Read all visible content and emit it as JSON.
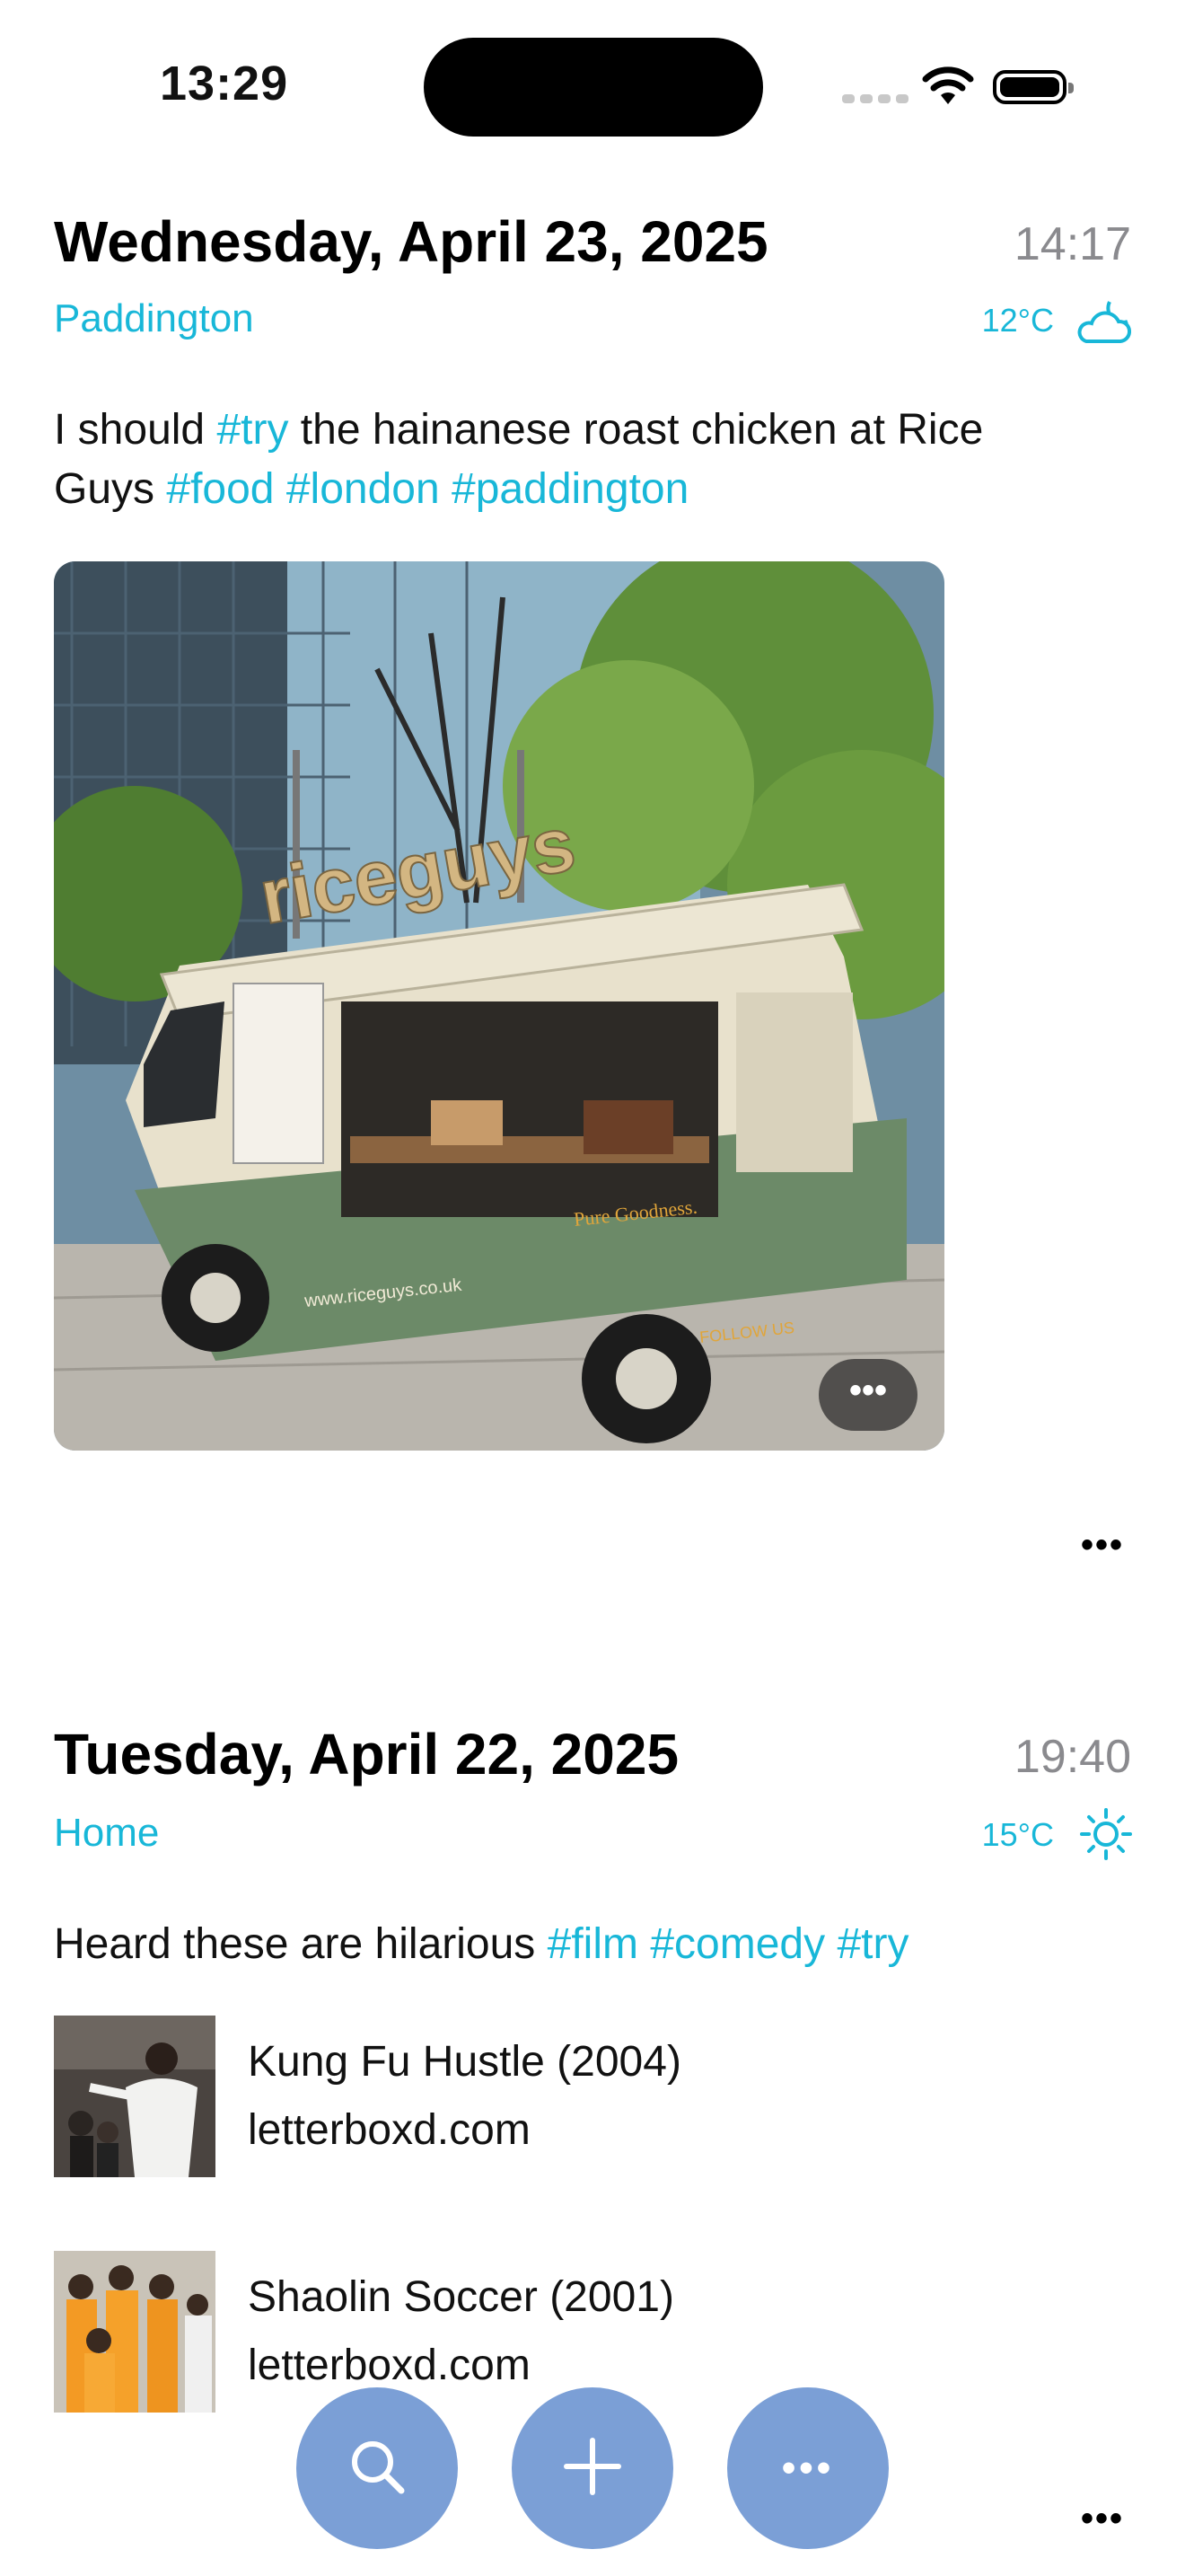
{
  "status_bar": {
    "time": "13:29"
  },
  "entries": [
    {
      "date": "Wednesday, April 23, 2025",
      "time": "14:17",
      "location": "Paddington",
      "temperature": "12°C",
      "weather_icon": "partly-cloudy-night-icon",
      "text_plain_1": "I should ",
      "tag_1": "#try",
      "text_plain_2": " the hainanese roast chicken at Rice Guys ",
      "tag_2": "#food",
      "tag_3": "#london",
      "tag_4": "#paddington",
      "photo": {
        "sign": "riceguys",
        "website": "www.riceguys.co.uk",
        "slogan": "Pure Goodness.",
        "follow": "FOLLOW US"
      },
      "photo_more_label": "•••",
      "more_label": "•••"
    },
    {
      "date": "Tuesday, April 22, 2025",
      "time": "19:40",
      "location": "Home",
      "temperature": "15°C",
      "weather_icon": "sun-icon",
      "text_plain_1": "Heard these are hilarious ",
      "tag_1": "#film",
      "tag_2": "#comedy",
      "tag_3": "#try",
      "links": [
        {
          "title": "Kung Fu Hustle (2004)",
          "domain": "letterboxd.com"
        },
        {
          "title": "Shaolin Soccer (2001)",
          "domain": "letterboxd.com"
        }
      ],
      "more_label": "•••"
    }
  ],
  "toolbar": {
    "search_icon": "search-icon",
    "add_icon": "plus-icon",
    "more_icon": "ellipsis-icon",
    "more_label": "•••"
  },
  "colors": {
    "accent": "#18b7d8",
    "fab": "#7b9fd6",
    "muted": "#8a8a8e"
  }
}
